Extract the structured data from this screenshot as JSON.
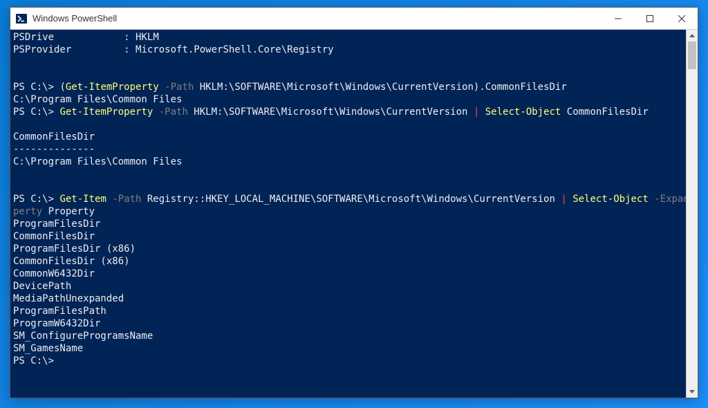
{
  "window": {
    "title": "Windows PowerShell"
  },
  "terminal": {
    "line01_label1": "PSDrive",
    "line01_sep": "            : ",
    "line01_val": "HKLM",
    "line02_label1": "PSProvider",
    "line02_sep": "         : ",
    "line02_val": "Microsoft.PowerShell.Core\\Registry",
    "blank": "",
    "cmd1_prompt": "PS C:\\> ",
    "cmd1_open": "(",
    "cmd1_cmdlet": "Get-ItemProperty",
    "cmd1_param": " -Path",
    "cmd1_arg": " HKLM:\\SOFTWARE\\Microsoft\\Windows\\CurrentVersion",
    "cmd1_close": ")",
    "cmd1_prop": ".CommonFilesDir",
    "cmd1_output": "C:\\Program Files\\Common Files",
    "cmd2_prompt": "PS C:\\> ",
    "cmd2_cmdlet": "Get-ItemProperty",
    "cmd2_param": " -Path",
    "cmd2_arg": " HKLM:\\SOFTWARE\\Microsoft\\Windows\\CurrentVersion ",
    "cmd2_pipe": "|",
    "cmd2_cmdlet2": " Select-Object",
    "cmd2_arg2": " CommonFilesDir",
    "cmd2_outhdr": "CommonFilesDir",
    "cmd2_outsep": "--------------",
    "cmd2_outval": "C:\\Program Files\\Common Files",
    "cmd3_prompt": "PS C:\\> ",
    "cmd3_cmdlet": "Get-Item",
    "cmd3_param": " -Path",
    "cmd3_arg": " Registry::HKEY_LOCAL_MACHINE\\SOFTWARE\\Microsoft\\Windows\\CurrentVersion ",
    "cmd3_pipe": "|",
    "cmd3_cmdlet2": " Select-Object",
    "cmd3_param2a": " -ExpandPro",
    "cmd3_param2b": "perty",
    "cmd3_arg2": " Property",
    "out3_01": "ProgramFilesDir",
    "out3_02": "CommonFilesDir",
    "out3_03": "ProgramFilesDir (x86)",
    "out3_04": "CommonFilesDir (x86)",
    "out3_05": "CommonW6432Dir",
    "out3_06": "DevicePath",
    "out3_07": "MediaPathUnexpanded",
    "out3_08": "ProgramFilesPath",
    "out3_09": "ProgramW6432Dir",
    "out3_10": "SM_ConfigureProgramsName",
    "out3_11": "SM_GamesName",
    "final_prompt": "PS C:\\>"
  }
}
